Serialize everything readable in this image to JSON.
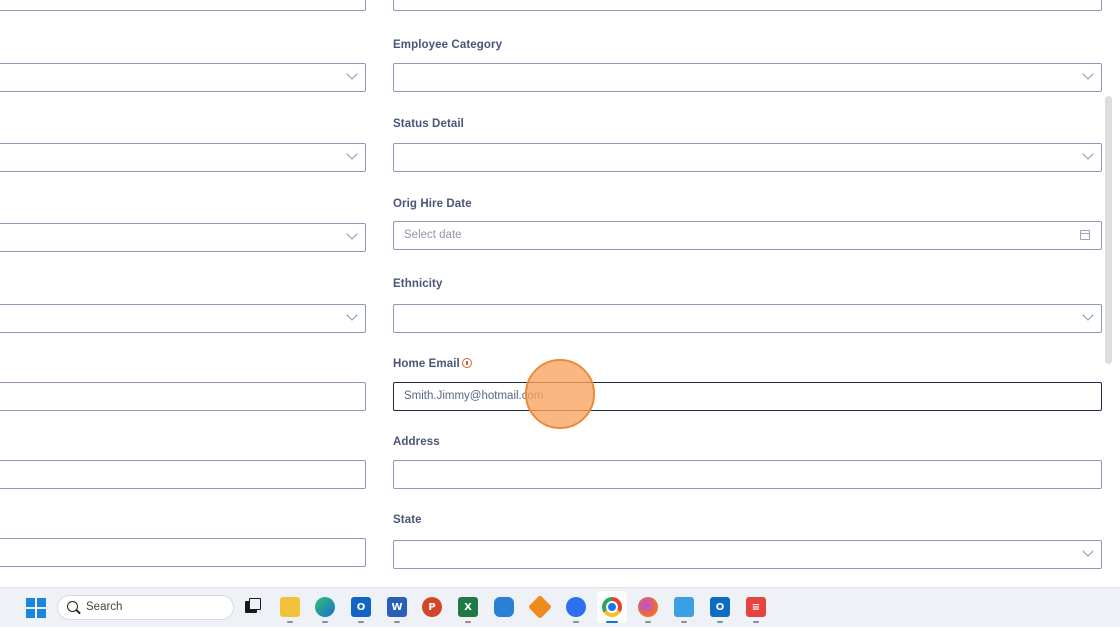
{
  "form": {
    "left_column": [
      {
        "kind": "select"
      },
      {
        "kind": "select"
      },
      {
        "kind": "select"
      },
      {
        "kind": "select"
      },
      {
        "kind": "input"
      },
      {
        "kind": "input"
      },
      {
        "kind": "input"
      }
    ],
    "employee_category": {
      "label": "Employee Category",
      "value": ""
    },
    "status_detail": {
      "label": "Status Detail",
      "value": ""
    },
    "orig_hire_date": {
      "label": "Orig Hire Date",
      "placeholder": "Select date"
    },
    "ethnicity": {
      "label": "Ethnicity",
      "value": ""
    },
    "home_email": {
      "label": "Home Email",
      "value": "Smith.Jimmy@hotmail.com"
    },
    "address": {
      "label": "Address",
      "value": ""
    },
    "state": {
      "label": "State",
      "value": ""
    }
  },
  "taskbar": {
    "search_label": "Search",
    "apps": [
      {
        "name": "task-view-icon"
      },
      {
        "name": "file-explorer-icon"
      },
      {
        "name": "edge-icon"
      },
      {
        "name": "outlook-icon"
      },
      {
        "name": "word-icon"
      },
      {
        "name": "powerpoint-icon"
      },
      {
        "name": "excel-icon"
      },
      {
        "name": "app-icon"
      },
      {
        "name": "app-icon"
      },
      {
        "name": "zoom-icon"
      },
      {
        "name": "chrome-icon"
      },
      {
        "name": "firefox-icon"
      },
      {
        "name": "notepad-icon"
      },
      {
        "name": "outlook-icon"
      },
      {
        "name": "todoist-icon"
      }
    ]
  },
  "colors": {
    "border": "#8e99b8",
    "focus_border": "#1f2a44",
    "info_icon": "#d9632a",
    "click_highlight": "#f8a35f",
    "taskbar_bg": "#eef2f6"
  }
}
